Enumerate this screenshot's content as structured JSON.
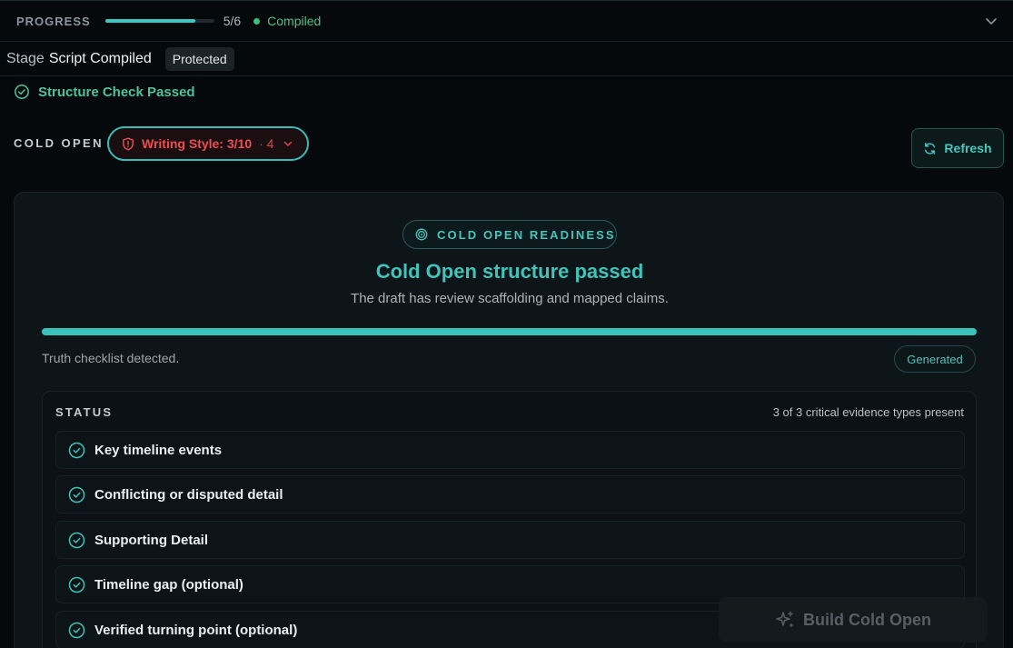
{
  "progress": {
    "label": "PROGRESS",
    "count": "5/6",
    "fraction": 0.83,
    "status": "Compiled",
    "status_color": "#3ac27a"
  },
  "stage": {
    "label": "Stage",
    "value": "Script Compiled",
    "badge": "Protected"
  },
  "structure_check": {
    "text": "Structure Check Passed",
    "icon": "check-circle-icon"
  },
  "cold_open": {
    "label": "COLD OPEN",
    "writing_style": "Writing Style: 3/10",
    "writing_count": "· 4",
    "writing_color": "#ef4d52",
    "writing_icon": "shield-alert-icon",
    "refresh_label": "Refresh"
  },
  "readiness": {
    "pill_label": "COLD OPEN READINESS",
    "title": "Cold Open structure passed",
    "subtitle": "The draft has review scaffolding and mapped claims.",
    "fill": 1.0,
    "note": "Truth checklist detected.",
    "badge": "Generated",
    "accent": "#3fc3ba"
  },
  "status": {
    "label": "STATUS",
    "count": "3 of 3 critical evidence types present",
    "items": [
      "Key timeline events",
      "Conflicting or disputed detail",
      "Supporting Detail",
      "Timeline gap (optional)",
      "Verified turning point (optional)"
    ]
  },
  "build": {
    "label": "Build Cold Open",
    "icon": "sparkles-icon"
  }
}
